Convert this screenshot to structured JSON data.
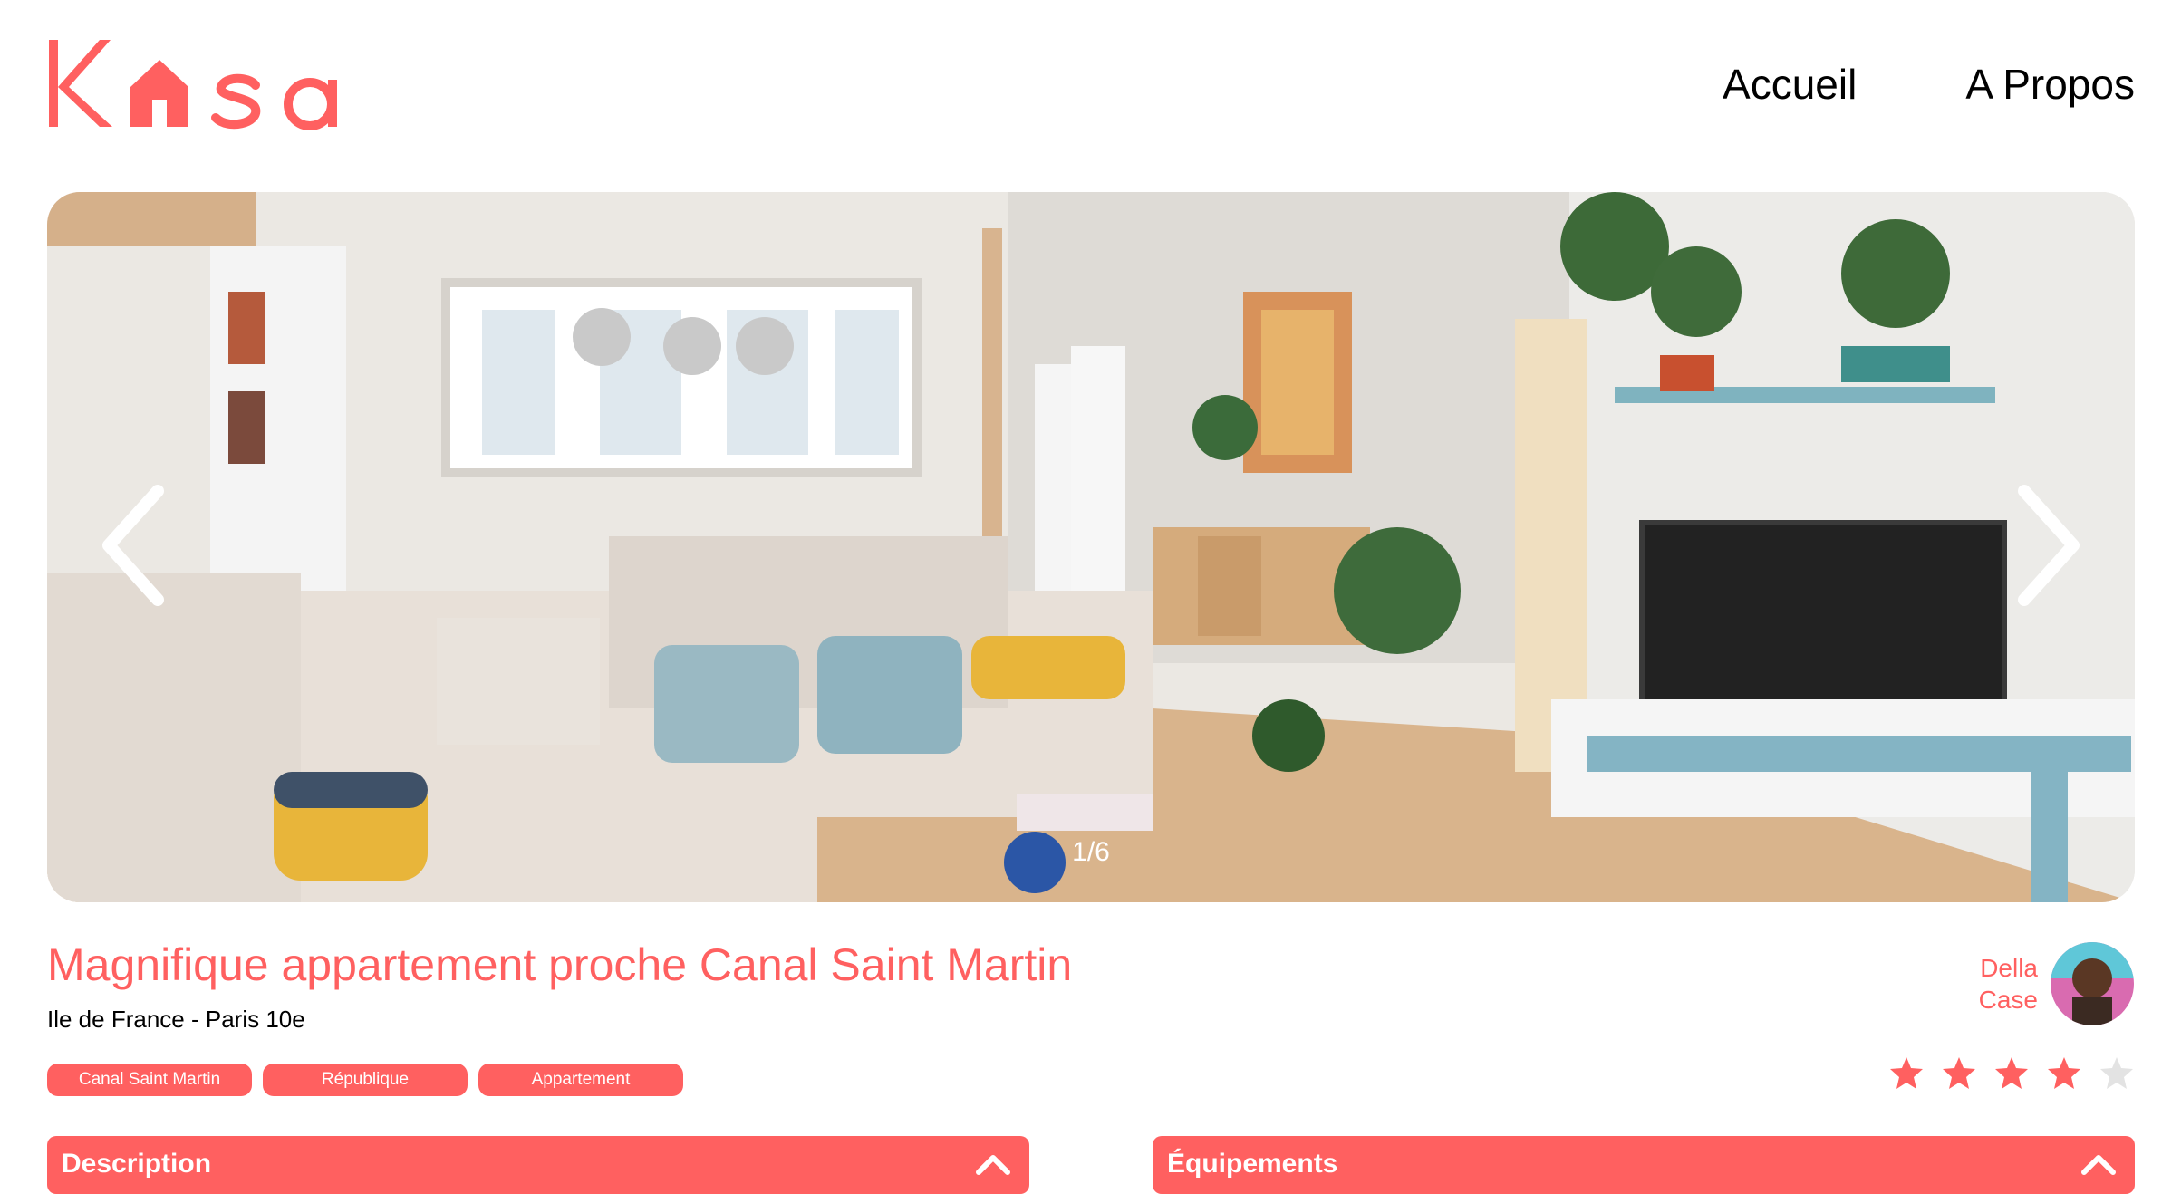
{
  "header": {
    "logo_text": "Kasa",
    "nav": [
      {
        "label": "Accueil"
      },
      {
        "label": "A Propos"
      }
    ]
  },
  "gallery": {
    "counter": "1/6",
    "current": 1,
    "total": 6
  },
  "listing": {
    "title": "Magnifique appartement proche Canal Saint Martin",
    "location": "Ile de France - Paris 10e",
    "tags": [
      "Canal Saint Martin",
      "République",
      "Appartement"
    ]
  },
  "host": {
    "first_name": "Della",
    "last_name": "Case"
  },
  "rating": {
    "value": 4,
    "max": 5
  },
  "collapses": {
    "description": "Description",
    "equipments": "Équipements"
  },
  "colors": {
    "accent": "#FF6060",
    "star_off": "#E3E3E3"
  }
}
